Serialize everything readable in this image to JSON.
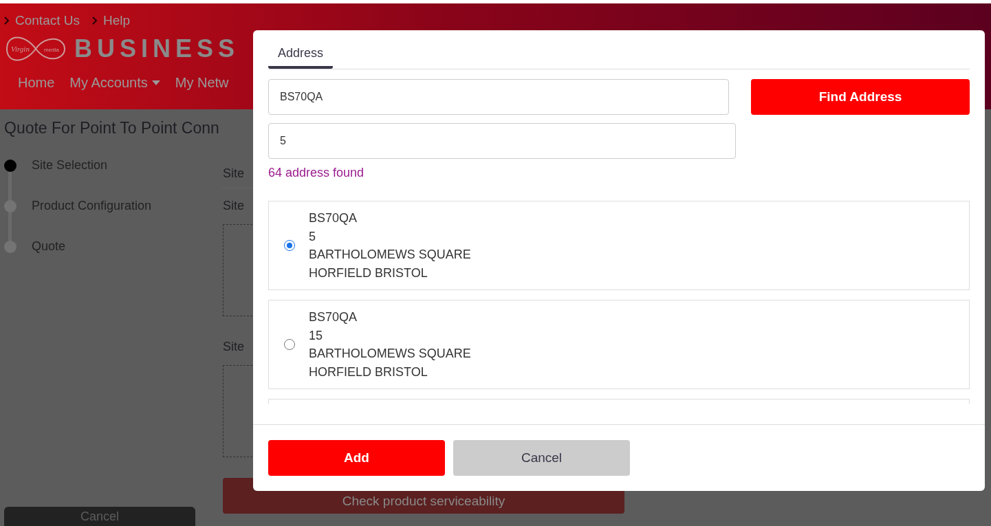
{
  "header": {
    "links": [
      "Contact Us",
      "Help"
    ],
    "logo": {
      "script": "Virgin",
      "sub": "media",
      "wordmark": "BUSINESS"
    },
    "nav": [
      {
        "label": "Home",
        "dropdown": false
      },
      {
        "label": "My Accounts",
        "dropdown": true
      },
      {
        "label": "My Netw",
        "dropdown": false
      }
    ]
  },
  "page": {
    "title": "Quote For Point To Point Conn",
    "steps": [
      {
        "label": "Site Selection",
        "selected": true
      },
      {
        "label": "Product Configuration",
        "selected": false
      },
      {
        "label": "Quote",
        "selected": false
      }
    ],
    "site_labels": [
      "Site",
      "Site",
      "Site"
    ],
    "check_button": "Check product serviceability",
    "cancel_button": "Cancel"
  },
  "modal": {
    "tabs": [
      {
        "label": "Address",
        "selected": true
      }
    ],
    "postcode": {
      "value": "BS70QA"
    },
    "find_button": "Find Address",
    "house": {
      "value": "5"
    },
    "result_count": "64 address found",
    "addresses": [
      {
        "lines": [
          "BS70QA",
          "5",
          "BARTHOLOMEWS SQUARE",
          "HORFIELD BRISTOL"
        ],
        "selected": true
      },
      {
        "lines": [
          "BS70QA",
          "15",
          "BARTHOLOMEWS SQUARE",
          "HORFIELD BRISTOL"
        ],
        "selected": false
      }
    ],
    "buttons": [
      {
        "label": "Add",
        "kind": "primary"
      },
      {
        "label": "Cancel",
        "kind": "secondary"
      }
    ]
  }
}
